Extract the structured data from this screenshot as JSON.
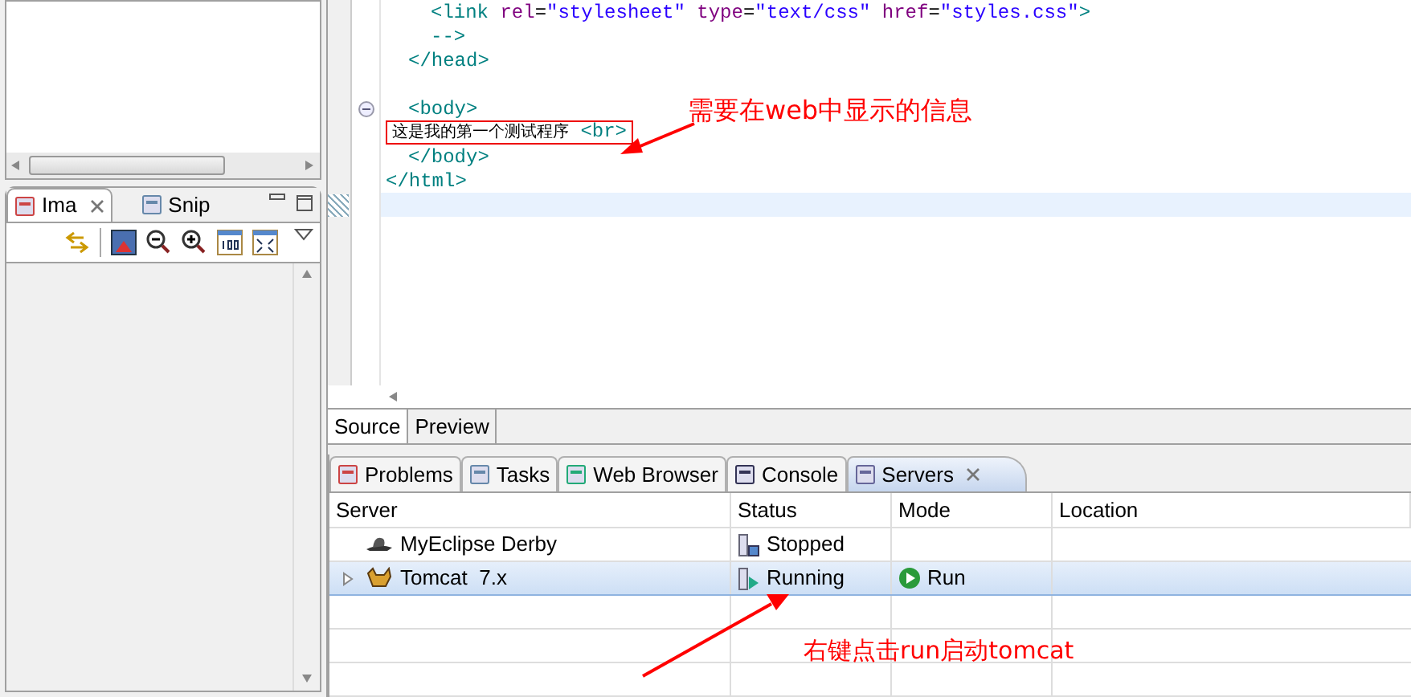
{
  "image_view": {
    "tabs": [
      {
        "label": "Ima",
        "selected": true,
        "closable": true
      },
      {
        "label": "Snip",
        "selected": false,
        "closable": false
      }
    ]
  },
  "editor": {
    "lines": [
      {
        "kind": "deep",
        "tokens": [
          {
            "kind": "tag",
            "text": "<link"
          },
          {
            "kind": "attr",
            "text": " rel"
          },
          {
            "kind": "text",
            "text": "="
          },
          {
            "kind": "value",
            "text": "\"stylesheet\""
          },
          {
            "kind": "attr",
            "text": " type"
          },
          {
            "kind": "text",
            "text": "="
          },
          {
            "kind": "value",
            "text": "\"text/css\""
          },
          {
            "kind": "attr",
            "text": " href"
          },
          {
            "kind": "text",
            "text": "="
          },
          {
            "kind": "value",
            "text": "\"styles.css\""
          },
          {
            "kind": "tag",
            "text": ">"
          }
        ]
      },
      {
        "kind": "deep",
        "tokens": [
          {
            "kind": "tag",
            "text": "-->"
          }
        ]
      },
      {
        "kind": "inner",
        "tokens": [
          {
            "kind": "tag",
            "text": "</head>"
          }
        ]
      },
      {
        "kind": "outer"
      },
      {
        "kind": "inner",
        "tokens": [
          {
            "kind": "tag",
            "text": "<body>"
          }
        ],
        "foldable": true
      },
      {
        "kind": "outer",
        "tokens": [
          {
            "kind": "cjk",
            "text": "这是我的第一个测试程序"
          },
          {
            "kind": "tag",
            "text": " <br>"
          }
        ],
        "boxed": true
      },
      {
        "kind": "inner",
        "tokens": [
          {
            "kind": "tag",
            "text": "</body>"
          }
        ]
      },
      {
        "kind": "outer",
        "tokens": [
          {
            "kind": "tag",
            "text": "</html>"
          }
        ]
      },
      {
        "kind": "outer",
        "current": true
      }
    ],
    "tabs": [
      {
        "label": "Source",
        "selected": true
      },
      {
        "label": "Preview",
        "selected": false
      }
    ]
  },
  "views": {
    "tabs": [
      {
        "label": "Problems",
        "selected": false,
        "closable": false
      },
      {
        "label": "Tasks",
        "selected": false,
        "closable": false
      },
      {
        "label": "Web Browser",
        "selected": false,
        "closable": false
      },
      {
        "label": "Console",
        "selected": false,
        "closable": false
      },
      {
        "label": "Servers",
        "selected": true,
        "closable": true
      }
    ]
  },
  "servers": {
    "columns": [
      "Server",
      "Status",
      "Mode",
      "Location"
    ],
    "rows": [
      {
        "server": "MyEclipse Derby",
        "kind": "derby",
        "status": "Stopped",
        "running": false,
        "selected": false,
        "expandable": false
      },
      {
        "server": "Tomcat  7.x",
        "kind": "tomcat",
        "status": "Running",
        "running": true,
        "mode": "Run",
        "selected": true,
        "expandable": true
      }
    ]
  },
  "annotations": [
    "需要在web中显示的信息",
    "右键点击run启动tomcat"
  ]
}
